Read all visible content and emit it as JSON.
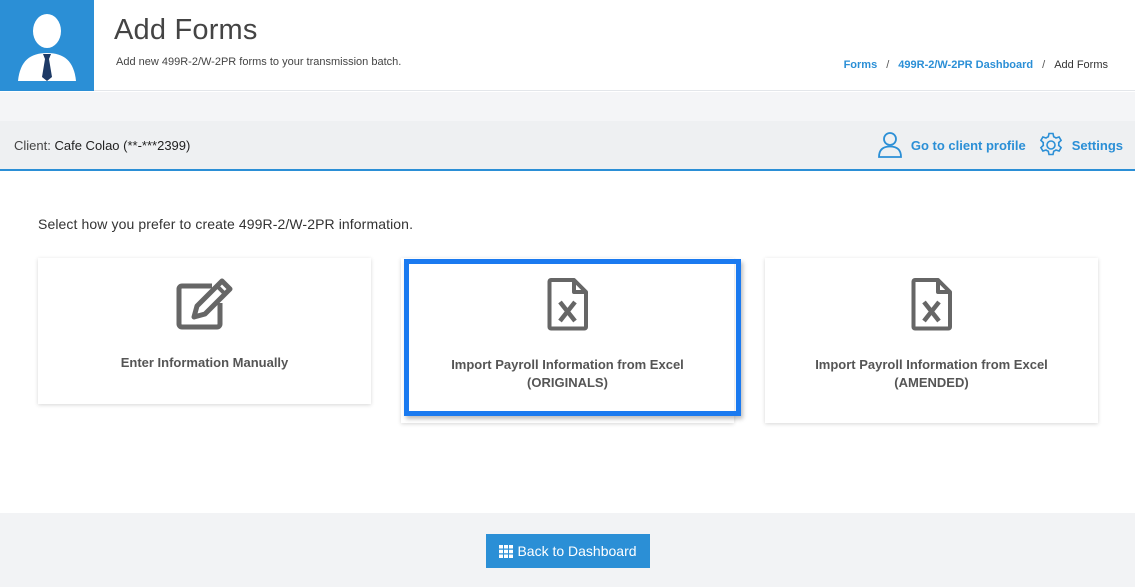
{
  "header": {
    "title": "Add Forms",
    "subtitle": "Add new 499R-2/W-2PR forms to your transmission batch.",
    "avatar_icon": "user-avatar-icon",
    "accent_color": "#2b8fd6"
  },
  "breadcrumb": {
    "items": [
      {
        "label": "Forms"
      },
      {
        "label": "499R-2/W-2PR Dashboard"
      }
    ],
    "separator": "/",
    "current": "Add Forms"
  },
  "client_bar": {
    "label": "Client:",
    "client_name": "Cafe Colao (**-***2399)",
    "profile_link": "Go to client profile",
    "settings_link": "Settings"
  },
  "main": {
    "prompt": "Select how you prefer to create 499R-2/W-2PR information.",
    "options": [
      {
        "icon": "edit-icon",
        "label": "Enter Information Manually"
      },
      {
        "icon": "excel-file-icon",
        "label_line1": "Import Payroll Information from Excel",
        "label_line2": "(ORIGINALS)"
      },
      {
        "icon": "excel-file-icon",
        "label_line1": "Import Payroll Information from Excel",
        "label_line2": "(AMENDED)"
      }
    ],
    "highlight_color": "#1a7af0"
  },
  "footer": {
    "back_button": "Back to Dashboard",
    "back_icon": "grid-icon"
  }
}
